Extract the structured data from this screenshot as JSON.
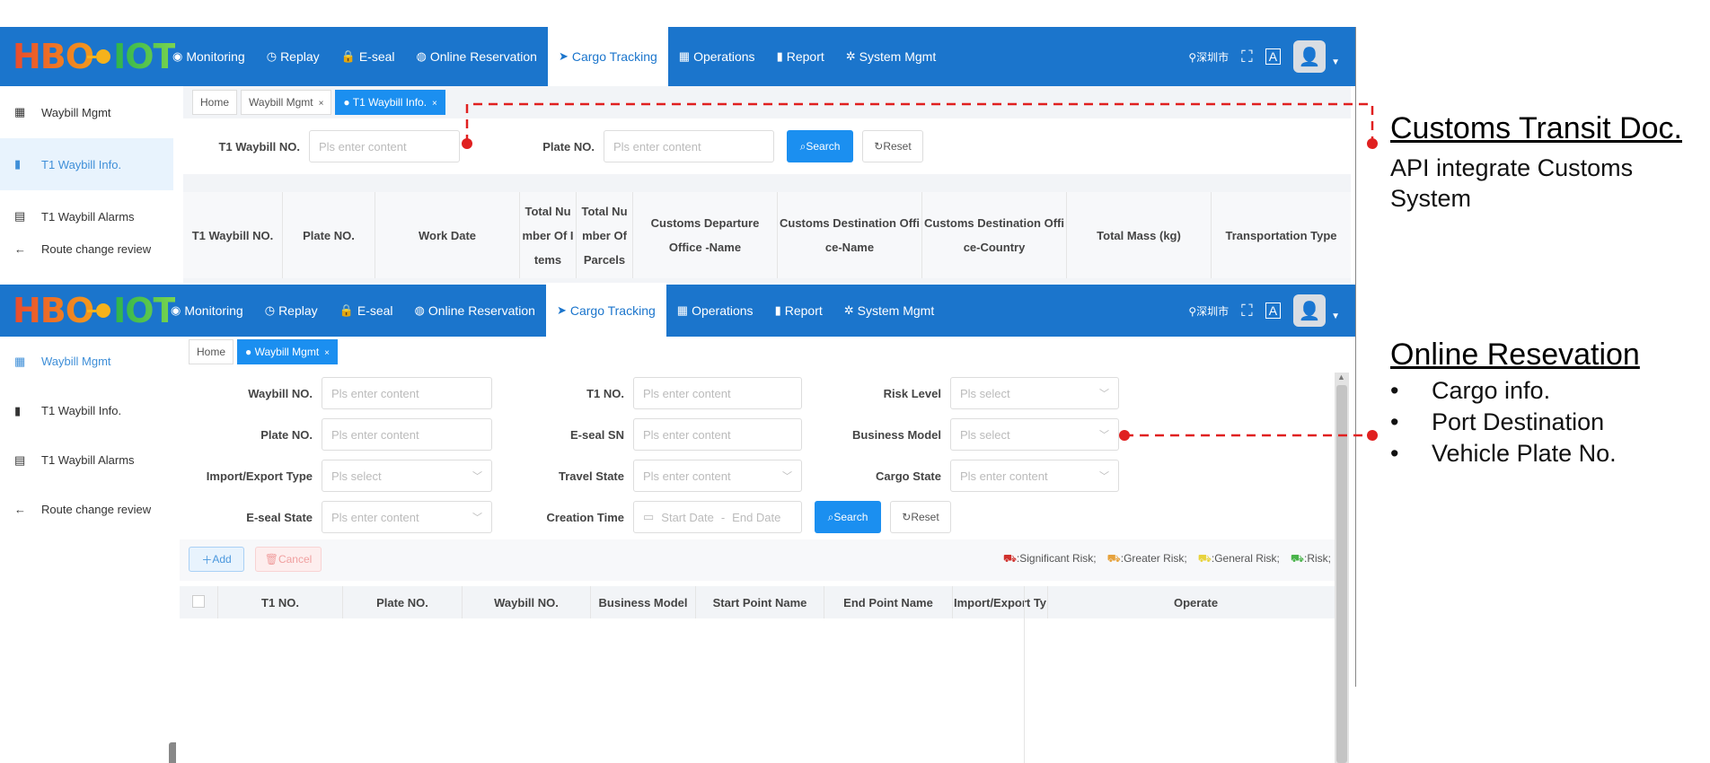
{
  "screen1": {
    "logo": {
      "left": "HBO",
      "right": "IOT"
    },
    "nav": [
      {
        "icon": "◉",
        "label": "Monitoring"
      },
      {
        "icon": "◷",
        "label": "Replay"
      },
      {
        "icon": "🔒",
        "label": "E-seal"
      },
      {
        "icon": "◍",
        "label": "Online Reservation"
      },
      {
        "icon": "➤",
        "label": "Cargo Tracking"
      },
      {
        "icon": "▦",
        "label": "Operations"
      },
      {
        "icon": "▮",
        "label": "Report"
      },
      {
        "icon": "✲",
        "label": "System Mgmt"
      }
    ],
    "location": "深圳市",
    "sidebar": [
      "Waybill Mgmt",
      "T1 Waybill Info.",
      "T1 Waybill Alarms",
      "Route change review"
    ],
    "tabs": [
      {
        "label": "Home"
      },
      {
        "label": "Waybill Mgmt"
      },
      {
        "label": "T1 Waybill Info."
      }
    ],
    "filters": {
      "t1_label": "T1 Waybill NO.",
      "t1_placeholder": "Pls enter content",
      "plate_label": "Plate NO.",
      "plate_placeholder": "Pls enter content",
      "search": "Search",
      "reset": "Reset"
    },
    "columns": [
      "T1 Waybill NO.",
      "Plate NO.",
      "Work Date",
      "Total Nu mber Of I tems",
      "Total Nu mber Of Parcels",
      "Customs Departure Office -Name",
      "Customs Destination Offi ce-Name",
      "Customs Destination Offi ce-Country",
      "Total Mass (kg)",
      "Transportation Type"
    ]
  },
  "screen2": {
    "logo": {
      "left": "HBO",
      "right": "IOT"
    },
    "nav": [
      {
        "icon": "◉",
        "label": "Monitoring"
      },
      {
        "icon": "◷",
        "label": "Replay"
      },
      {
        "icon": "🔒",
        "label": "E-seal"
      },
      {
        "icon": "◍",
        "label": "Online Reservation"
      },
      {
        "icon": "➤",
        "label": "Cargo Tracking"
      },
      {
        "icon": "▦",
        "label": "Operations"
      },
      {
        "icon": "▮",
        "label": "Report"
      },
      {
        "icon": "✲",
        "label": "System Mgmt"
      }
    ],
    "location": "深圳市",
    "sidebar": [
      "Waybill Mgmt",
      "T1 Waybill Info.",
      "T1 Waybill Alarms",
      "Route change review"
    ],
    "tabs": [
      {
        "label": "Home"
      },
      {
        "label": "Waybill Mgmt"
      }
    ],
    "form": {
      "waybill_label": "Waybill NO.",
      "waybill_ph": "Pls enter content",
      "t1_label": "T1 NO.",
      "t1_ph": "Pls enter content",
      "risk_label": "Risk Level",
      "risk_ph": "Pls select",
      "plate_label": "Plate NO.",
      "plate_ph": "Pls enter content",
      "eseal_label": "E-seal SN",
      "eseal_ph": "Pls enter content",
      "business_label": "Business Model",
      "business_ph": "Pls select",
      "ie_label": "Import/Export Type",
      "ie_ph": "Pls select",
      "travel_label": "Travel State",
      "travel_ph": "Pls enter content",
      "cargo_label": "Cargo State",
      "cargo_ph": "Pls enter content",
      "esealstate_label": "E-seal State",
      "esealstate_ph": "Pls enter content",
      "creation_label": "Creation Time",
      "start_ph": "Start Date",
      "dash": "-",
      "end_ph": "End Date",
      "search": "Search",
      "reset": "Reset"
    },
    "actions": {
      "add": "Add",
      "cancel": "Cancel"
    },
    "legend": [
      {
        "label": ":Significant Risk;",
        "color": "#d0312d"
      },
      {
        "label": ":Greater Risk;",
        "color": "#e6a23c"
      },
      {
        "label": ":General Risk;",
        "color": "#e8d33c"
      },
      {
        "label": ":Risk;",
        "color": "#49b34a"
      }
    ],
    "columns": [
      "T1 NO.",
      "Plate NO.",
      "Waybill NO.",
      "Business Model",
      "Start Point Name",
      "End Point Name",
      "Import/Export Ty",
      "Operate"
    ]
  },
  "callouts": {
    "customs": {
      "title": "Customs Transit Doc.",
      "text": "API integrate Customs System"
    },
    "online": {
      "title": "Online Resevation",
      "bullets": [
        "Cargo info.",
        "Port Destination",
        "Vehicle Plate No."
      ]
    },
    "marker_color": "#e02020"
  }
}
